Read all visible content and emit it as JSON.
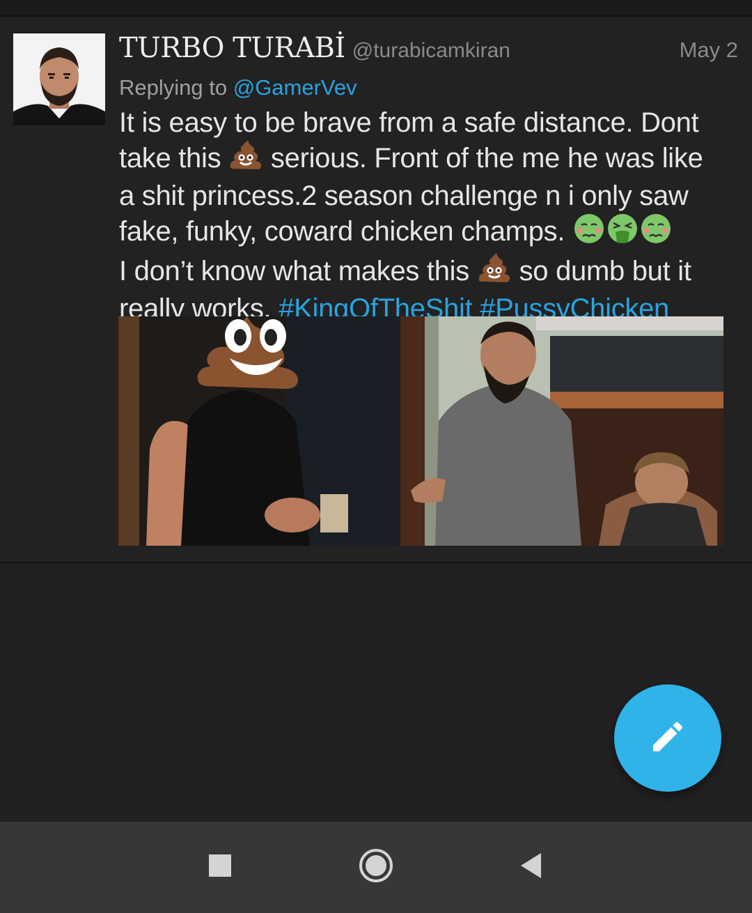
{
  "tweet": {
    "author_name": "TURBO TURABİ",
    "author_handle": "@turabicamkiran",
    "date": "May 2",
    "replying_prefix": "Replying to",
    "replying_to": "@GamerVev",
    "text_lines": [
      "It is easy to be brave from a safe distance. Dont",
      "take this",
      "serious. Front of the me he was like",
      "a shit princess.2 season challenge n i only saw",
      "fake, funky, coward chicken champs.",
      "I don’t know what makes this",
      "so dumb but it",
      "really works."
    ],
    "hashtags": [
      "#KingOfTheShit",
      "#PussyChicken"
    ],
    "emojis": [
      "poop-emoji",
      "nauseated-face-emoji",
      "vomiting-face-emoji",
      "nauseated-face-emoji",
      "poop-emoji"
    ]
  },
  "media": {
    "type": "photo",
    "overlay_emoji": "poop-emoji"
  },
  "fab": {
    "icon": "pencil-icon"
  },
  "navbar": {
    "icons": [
      "recents-square-icon",
      "home-circle-icon",
      "back-triangle-icon"
    ]
  },
  "colors": {
    "background": "#212121",
    "link": "#29a3e0",
    "fab": "#2fb3e8",
    "navbar": "#373737"
  }
}
